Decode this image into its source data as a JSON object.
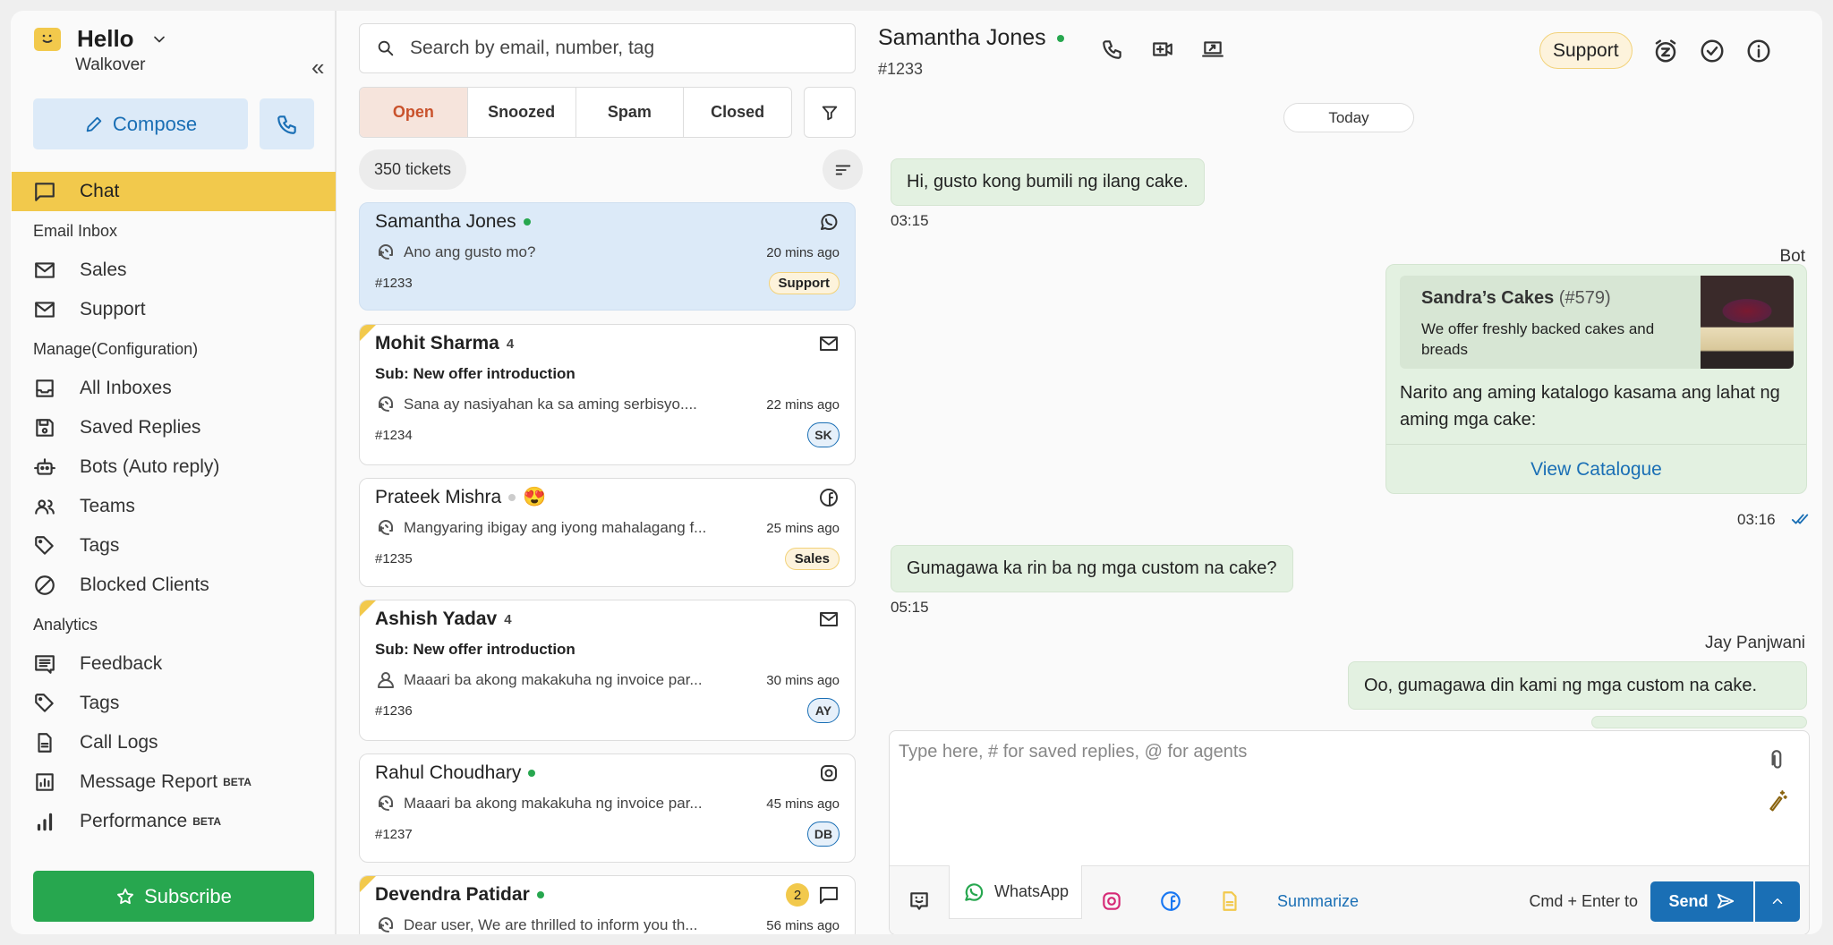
{
  "colors": {
    "accent_yellow": "#f2c94c",
    "primary_blue": "#1a6fb5",
    "subscribe_green": "#27a74f",
    "bubble_green": "#e3f1e1",
    "selected_card": "#dceaf8",
    "open_tab": "#c9522c"
  },
  "sidebar": {
    "brand": "Hello",
    "org": "Walkover",
    "collapse": "«",
    "compose": "Compose",
    "subscribe": "Subscribe",
    "chat": "Chat",
    "email_inbox": "Email Inbox",
    "email_items": [
      {
        "label": "Sales",
        "icon": "mail-icon"
      },
      {
        "label": "Support",
        "icon": "mail-icon"
      }
    ],
    "manage": "Manage(Configuration)",
    "manage_items": [
      {
        "label": "All Inboxes",
        "icon": "inbox-icon"
      },
      {
        "label": "Saved Replies",
        "icon": "save-icon"
      },
      {
        "label": "Bots (Auto reply)",
        "icon": "bot-icon"
      },
      {
        "label": "Teams",
        "icon": "team-icon"
      },
      {
        "label": "Tags",
        "icon": "tag-icon"
      },
      {
        "label": "Blocked Clients",
        "icon": "block-icon"
      }
    ],
    "analytics": "Analytics",
    "analytics_items": [
      {
        "label": "Feedback",
        "icon": "feedback-icon"
      },
      {
        "label": "Tags",
        "icon": "tag-icon"
      },
      {
        "label": "Call Logs",
        "icon": "document-icon"
      },
      {
        "label": "Message Report",
        "icon": "report-icon",
        "badge": "BETA"
      },
      {
        "label": "Performance",
        "icon": "bar-chart-icon",
        "badge": "BETA"
      }
    ]
  },
  "list": {
    "search_placeholder": "Search by email, number, tag",
    "tabs": [
      "Open",
      "Snoozed",
      "Spam",
      "Closed"
    ],
    "active_tab": "Open",
    "count": "350 tickets",
    "tickets": [
      {
        "name": "Samantha Jones",
        "status": "online",
        "channel": "whatsapp",
        "preview": "Ano ang gusto mo?",
        "time": "20 mins ago",
        "id": "#1233",
        "tag": "Support",
        "selected": true
      },
      {
        "name": "Mohit Sharma",
        "unread": "4",
        "channel": "email",
        "subject": "Sub: New offer introduction",
        "preview": "Sana ay nasiyahan ka sa aming serbisyo....",
        "time": "22 mins ago",
        "id": "#1234",
        "assignee": "SK",
        "flag": true
      },
      {
        "name": "Prateek Mishra",
        "status": "offline",
        "emoji": "😍",
        "channel": "facebook",
        "preview": "Mangyaring ibigay ang iyong mahalagang f...",
        "time": "25 mins ago",
        "id": "#1235",
        "tag": "Sales"
      },
      {
        "name": "Ashish Yadav",
        "unread": "4",
        "channel": "email",
        "subject": "Sub: New offer introduction",
        "preview": "Maaari ba akong makakuha ng invoice par...",
        "time": "30 mins ago",
        "id": "#1236",
        "assignee": "AY",
        "flag": true
      },
      {
        "name": "Rahul Choudhary",
        "status": "online",
        "channel": "instagram",
        "preview": "Maaari ba akong makakuha ng invoice par...",
        "time": "45 mins ago",
        "id": "#1237",
        "assignee": "DB"
      },
      {
        "name": "Devendra Patidar",
        "status": "online",
        "channel": "chat",
        "badge": "2",
        "preview": "Dear user, We are thrilled to inform you th...",
        "time": "56 mins ago",
        "flag": true
      }
    ]
  },
  "chat": {
    "name": "Samantha Jones",
    "id": "#1233",
    "tag": "Support",
    "date": "Today",
    "messages": [
      {
        "text": "Hi, gusto kong bumili ng ilang cake.",
        "time": "03:15"
      },
      {
        "sender": "Bot",
        "product_title": "Sandra’s Cakes",
        "product_id": "(#579)",
        "product_desc": "We offer freshly backed cakes and breads",
        "text": "Narito ang aming katalogo kasama ang lahat ng aming mga cake:",
        "button": "View Catalogue",
        "time": "03:16"
      },
      {
        "text": "Gumagawa ka rin ba ng mga custom na cake?",
        "time": "05:15"
      },
      {
        "sender": "Jay Panjwani",
        "text": "Oo, gumagawa din kami ng mga custom na cake."
      }
    ],
    "composer": {
      "placeholder": "Type here, # for saved replies, @ for agents",
      "channel": "WhatsApp",
      "summarize": "Summarize",
      "hint": "Cmd + Enter to",
      "send": "Send"
    }
  }
}
